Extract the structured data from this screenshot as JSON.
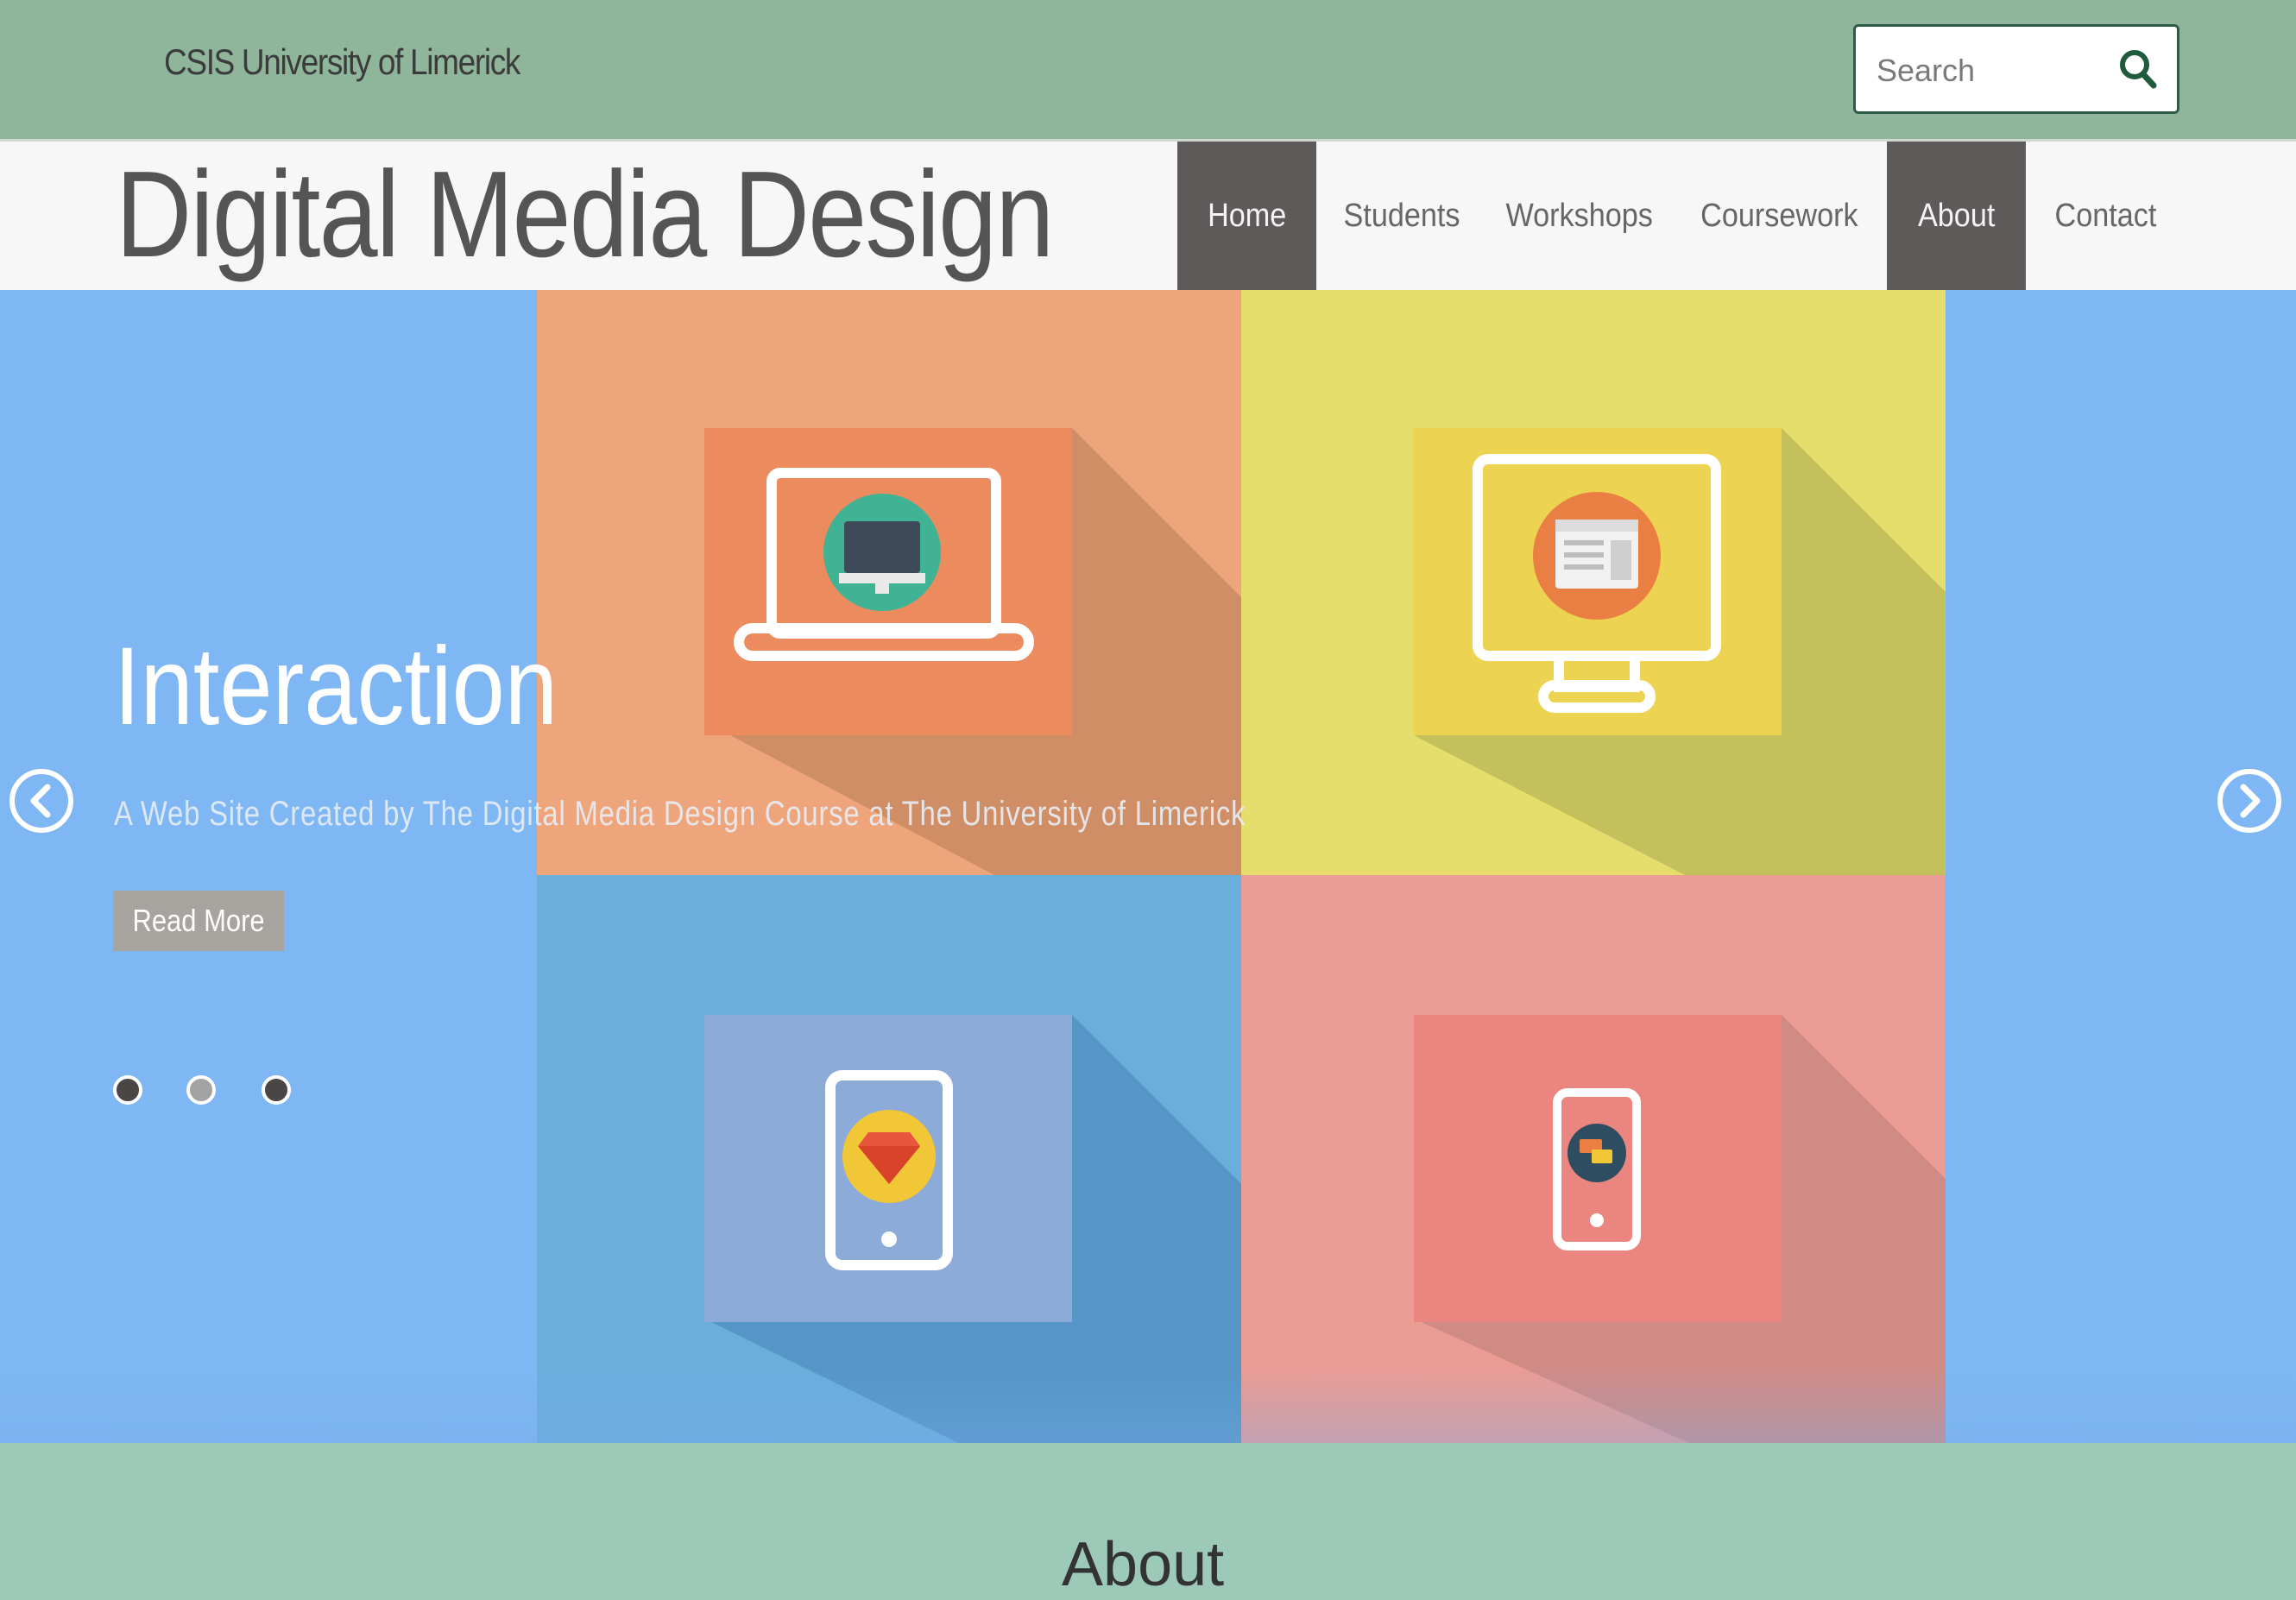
{
  "topbar": {
    "brand": "CSIS University of Limerick",
    "search_placeholder": "Search",
    "search_icon": "search-icon"
  },
  "header": {
    "title": "Digital Media Design",
    "nav": [
      {
        "label": "Home",
        "active": true
      },
      {
        "label": "Students",
        "active": false
      },
      {
        "label": "Workshops",
        "active": false
      },
      {
        "label": "Coursework",
        "active": false
      },
      {
        "label": "About",
        "active": true
      },
      {
        "label": "Contact",
        "active": false
      }
    ]
  },
  "hero": {
    "heading": "Interaction",
    "subheading": "A Web Site Created by The Digital Media Design Course at The University of Limerick",
    "button_label": "Read More",
    "prev_icon": "chevron-left-circle-icon",
    "next_icon": "chevron-right-circle-icon",
    "dots": [
      {
        "state": "inactive",
        "color": "#4a4646"
      },
      {
        "state": "active",
        "color": "#a3a3a3"
      },
      {
        "state": "inactive",
        "color": "#4a4646"
      }
    ],
    "tiles": [
      {
        "icon": "laptop-icon",
        "color": "#efa57b"
      },
      {
        "icon": "desktop-monitor-icon",
        "color": "#e5dd6c"
      },
      {
        "icon": "tablet-icon",
        "color": "#6aaedc"
      },
      {
        "icon": "smartphone-icon",
        "color": "#eb9c94"
      }
    ]
  },
  "about": {
    "heading": "About"
  },
  "colors": {
    "topbar": "#8fb59b",
    "nav_active": "#5e5a59",
    "hero_bg": "#7fb7f4",
    "section_bg": "#9cc9b8"
  }
}
